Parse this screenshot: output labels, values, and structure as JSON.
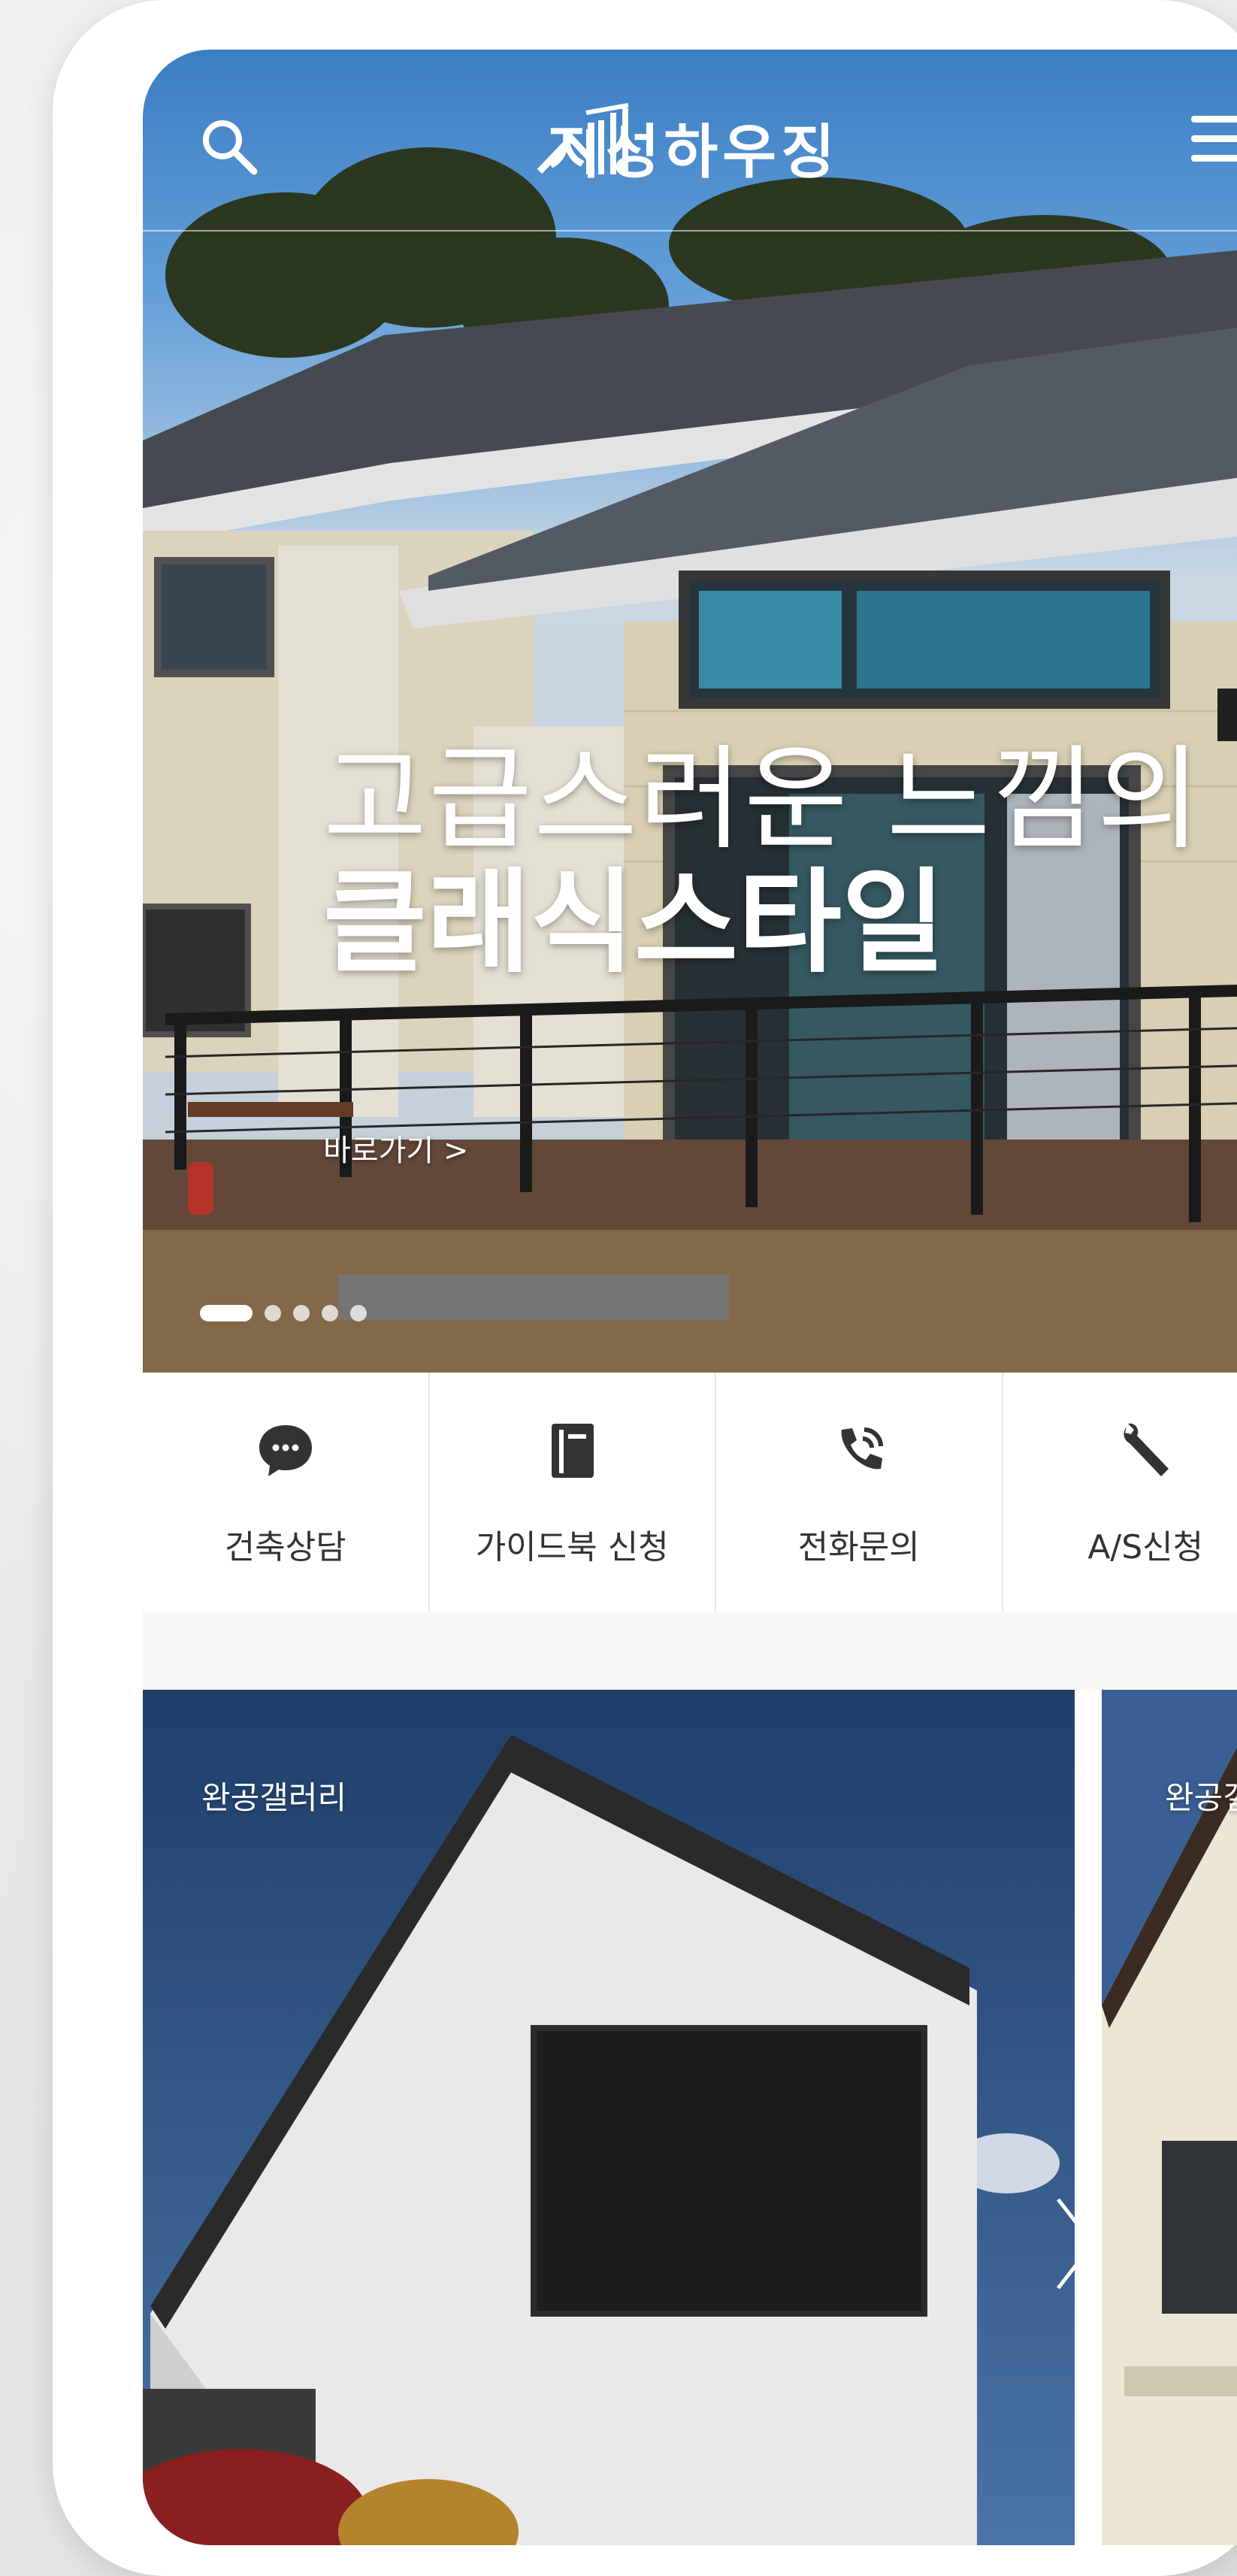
{
  "header": {
    "brand": "지성하우징",
    "icons": {
      "search": "search-icon",
      "menu": "hamburger-menu-icon",
      "logo": "house-logo-icon"
    }
  },
  "hero": {
    "line1": "고급스러운 느낌의",
    "line2": "클래식스타일",
    "link": "바로가기 >",
    "slides_total": 5,
    "active_slide": 1
  },
  "quick_menu": [
    {
      "label": "건축상담",
      "icon": "chat-bubble-icon"
    },
    {
      "label": "가이드북 신청",
      "icon": "book-icon"
    },
    {
      "label": "전화문의",
      "icon": "phone-icon"
    },
    {
      "label": "A/S신청",
      "icon": "wrench-icon"
    }
  ],
  "gallery": {
    "cards": [
      {
        "label": "완공갤러리"
      },
      {
        "label": "완공갤러리"
      }
    ],
    "next_icon": "chevron-right-icon"
  },
  "colors": {
    "accent": "#ffffff",
    "text": "#333333",
    "divider": "#e6e6e6"
  }
}
